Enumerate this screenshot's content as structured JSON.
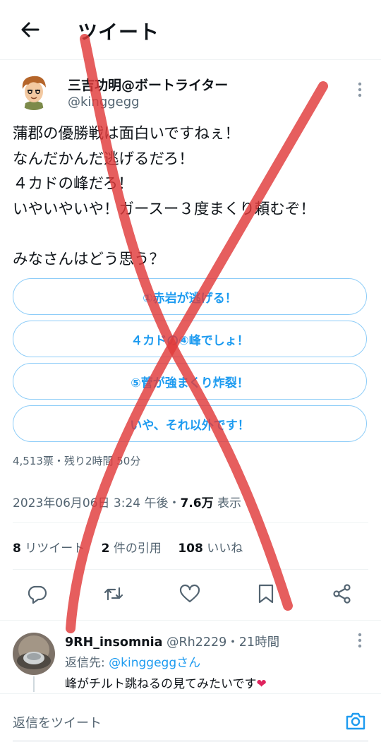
{
  "header": {
    "title": "ツイート",
    "back_icon": "arrow-left-icon"
  },
  "tweet": {
    "display_name": "三吉功明@ボートライター",
    "handle": "@kinggegg",
    "text": "蒲郡の優勝戦は面白いですねぇ！\nなんだかんだ逃げるだろ！\n４カドの峰だろ！\nいやいやいや！ガースー３度まくり頼むぞ！\n\nみなさんはどう思う？",
    "poll": {
      "options": [
        "①赤岩が逃げる！",
        "４カドの④峰でしょ！",
        "⑤菅が強まくり炸裂！",
        "いや、それ以外です！"
      ],
      "meta": "4,513票・残り2時間 50分"
    },
    "timestamp": "2023年06月06日 3:24 午後・",
    "views_count": "7.6万",
    "views_label": " 表示",
    "stats": {
      "retweets_count": "8",
      "retweets_label": " リツイート",
      "quotes_count": "2",
      "quotes_label": " 件の引用",
      "likes_count": "108",
      "likes_label": " いいね"
    }
  },
  "reply": {
    "name": "9RH_insomnia",
    "meta": " @Rh2229・21時間",
    "reply_to_label": "返信先: ",
    "reply_to_link": "@kinggeggさん",
    "text": "峰がチルト跳ねるの見てみたいです",
    "emoji": "❤"
  },
  "composer": {
    "placeholder": "返信をツイート"
  },
  "colors": {
    "accent": "#1d9bf0",
    "muted": "#536471",
    "text": "#0f1419",
    "cross": "#e03a3a"
  }
}
